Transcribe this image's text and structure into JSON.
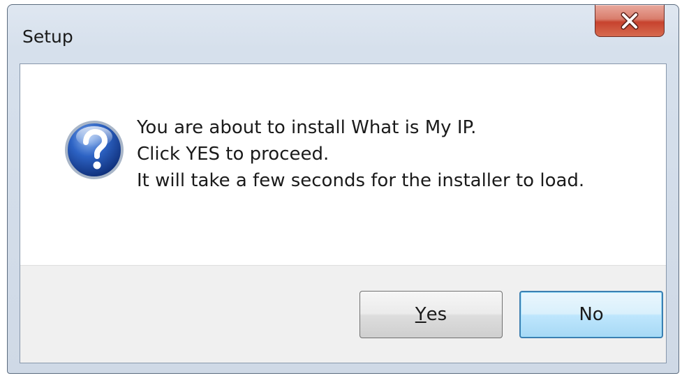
{
  "window": {
    "title": "Setup"
  },
  "icons": {
    "close": "close-icon",
    "question": "question-icon"
  },
  "message": {
    "lines": [
      "You are about to install What is My IP.",
      "Click YES to proceed.",
      "It will take a few seconds for the installer to load."
    ]
  },
  "buttons": {
    "yes_mnemonic": "Y",
    "yes_rest": "es",
    "no_label": "No"
  },
  "colors": {
    "close_button": "#c7432e",
    "default_button_border": "#3c7fb1",
    "question_icon": "#1f4fa8"
  }
}
